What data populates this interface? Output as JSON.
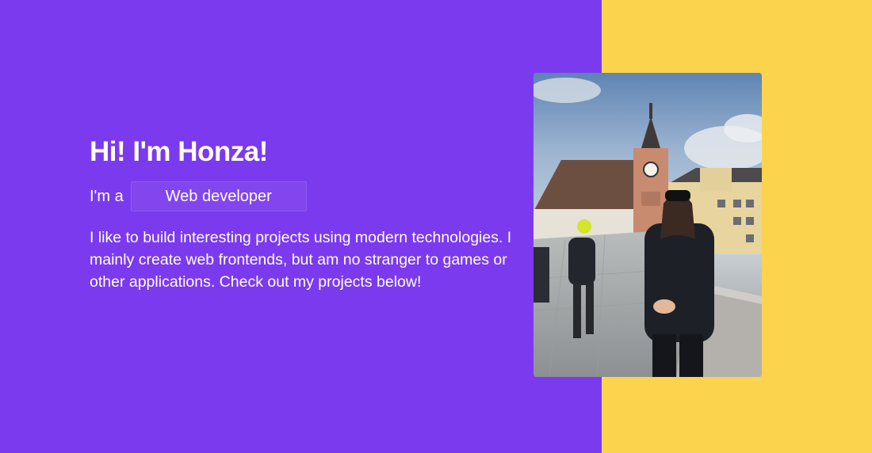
{
  "hero": {
    "heading": "Hi! I'm Honza!",
    "role_prefix": "I'm a",
    "role_current": "Web developer",
    "bio": "I like to build interesting projects using modern technologies. I mainly create web frontends, but am no stranger to games or other applications. Check out my projects below!"
  },
  "photo": {
    "alt": "Honza standing on a stone bridge in front of a clock tower"
  },
  "colors": {
    "primary_bg": "#7b3aed",
    "accent_bg": "#fcd34d",
    "text": "#ffffff"
  }
}
